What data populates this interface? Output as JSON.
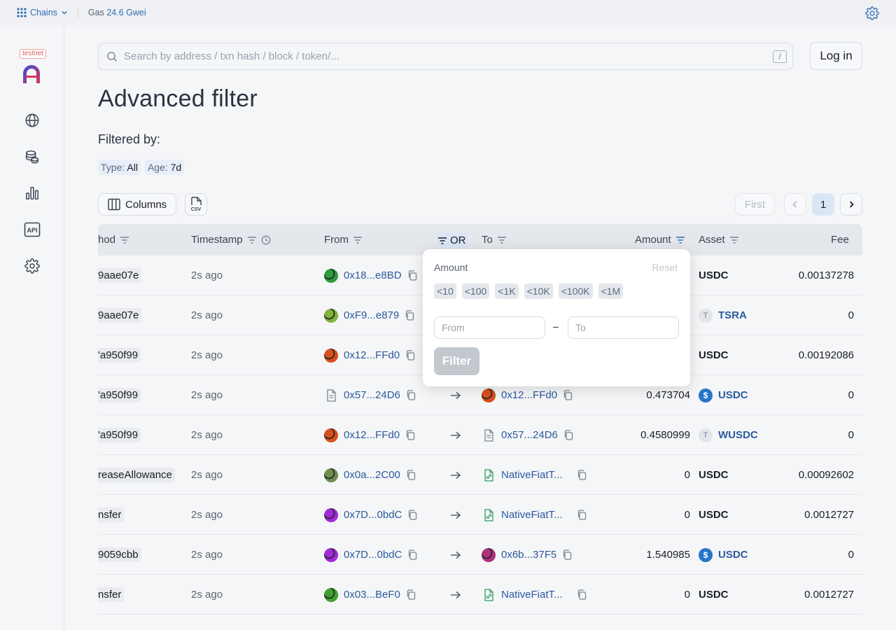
{
  "topbar": {
    "chains_label": "Chains",
    "gas_label": "Gas",
    "gas_value": "24.6 Gwei"
  },
  "sidebar": {
    "badge": "testnet",
    "items": [
      "globe-icon",
      "tokens-icon",
      "chart-icon",
      "api-icon",
      "gear-icon"
    ],
    "api_label": "API"
  },
  "search": {
    "placeholder": "Search by address / txn hash / block / token/...",
    "shortcut": "/"
  },
  "login_label": "Log in",
  "page_title": "Advanced filter",
  "filtered_by": "Filtered by:",
  "filters": [
    {
      "key": "Type:",
      "value": "All"
    },
    {
      "key": "Age:",
      "value": "7d"
    }
  ],
  "toolbar": {
    "columns_label": "Columns",
    "csv_label": "CSV"
  },
  "pagination": {
    "first": "First",
    "current": "1"
  },
  "table": {
    "headers": {
      "method": "hod",
      "timestamp": "Timestamp",
      "from": "From",
      "or": "OR",
      "to": "To",
      "amount": "Amount",
      "asset": "Asset",
      "fee": "Fee"
    },
    "rows": [
      {
        "method": "9aae07e",
        "time": "2s ago",
        "from": "0x18...e8BD",
        "from_av": "#2e9b3e",
        "to": "",
        "to_type": "none",
        "amount": "",
        "asset": "USDC",
        "asset_icon": "none",
        "asset_link": false,
        "fee": "0.00137278"
      },
      {
        "method": "9aae07e",
        "time": "2s ago",
        "from": "0xF9...e879",
        "from_av": "#7fb33a",
        "to": "",
        "to_type": "none",
        "amount": "",
        "asset": "TSRA",
        "asset_icon": "t",
        "asset_link": true,
        "fee": "0"
      },
      {
        "method": "'a950f99",
        "time": "2s ago",
        "from": "0x12...FFd0",
        "from_av": "#d8501e",
        "to": "",
        "to_type": "none",
        "amount": "",
        "asset": "USDC",
        "asset_icon": "none",
        "asset_link": false,
        "fee": "0.00192086"
      },
      {
        "method": "'a950f99",
        "time": "2s ago",
        "from": "0x57...24D6",
        "from_av": "doc",
        "to": "0x12...FFd0",
        "to_type": "#d8501e",
        "amount": "0.473704",
        "asset": "USDC",
        "asset_icon": "usdc",
        "asset_link": true,
        "fee": "0"
      },
      {
        "method": "'a950f99",
        "time": "2s ago",
        "from": "0x12...FFd0",
        "from_av": "#d8501e",
        "to": "0x57...24D6",
        "to_type": "doc",
        "amount": "0.4580999",
        "asset": "WUSDC",
        "asset_icon": "t",
        "asset_link": true,
        "fee": "0"
      },
      {
        "method": "reaseAllowance",
        "time": "2s ago",
        "from": "0x0a...2C00",
        "from_av": "#6b8e4e",
        "to": "NativeFiatT...",
        "to_type": "contract",
        "amount": "0",
        "asset": "USDC",
        "asset_icon": "none",
        "asset_link": false,
        "fee": "0.00092602"
      },
      {
        "method": "nsfer",
        "time": "2s ago",
        "from": "0x7D...0bdC",
        "from_av": "#a32ad8",
        "to": "NativeFiatT...",
        "to_type": "contract",
        "amount": "0",
        "asset": "USDC",
        "asset_icon": "none",
        "asset_link": false,
        "fee": "0.0012727"
      },
      {
        "method": "9059cbb",
        "time": "2s ago",
        "from": "0x7D...0bdC",
        "from_av": "#a32ad8",
        "to": "0x6b...37F5",
        "to_type": "#b0307a",
        "amount": "1.540985",
        "asset": "USDC",
        "asset_icon": "usdc",
        "asset_link": true,
        "fee": "0"
      },
      {
        "method": "nsfer",
        "time": "2s ago",
        "from": "0x03...BeF0",
        "from_av": "#3fa02e",
        "to": "NativeFiatT...",
        "to_type": "contract",
        "amount": "0",
        "asset": "USDC",
        "asset_icon": "none",
        "asset_link": false,
        "fee": "0.0012727"
      }
    ]
  },
  "amount_filter": {
    "title": "Amount",
    "reset": "Reset",
    "presets": [
      "<10",
      "<100",
      "<1K",
      "<10K",
      "<100K",
      "<1M"
    ],
    "from_placeholder": "From",
    "to_placeholder": "To",
    "dash": "–",
    "button": "Filter"
  },
  "colors": {
    "accent": "#2b6cb0",
    "link": "#2b5a9b",
    "usdc": "#2775ca",
    "header_bg": "#e4e7ec"
  }
}
